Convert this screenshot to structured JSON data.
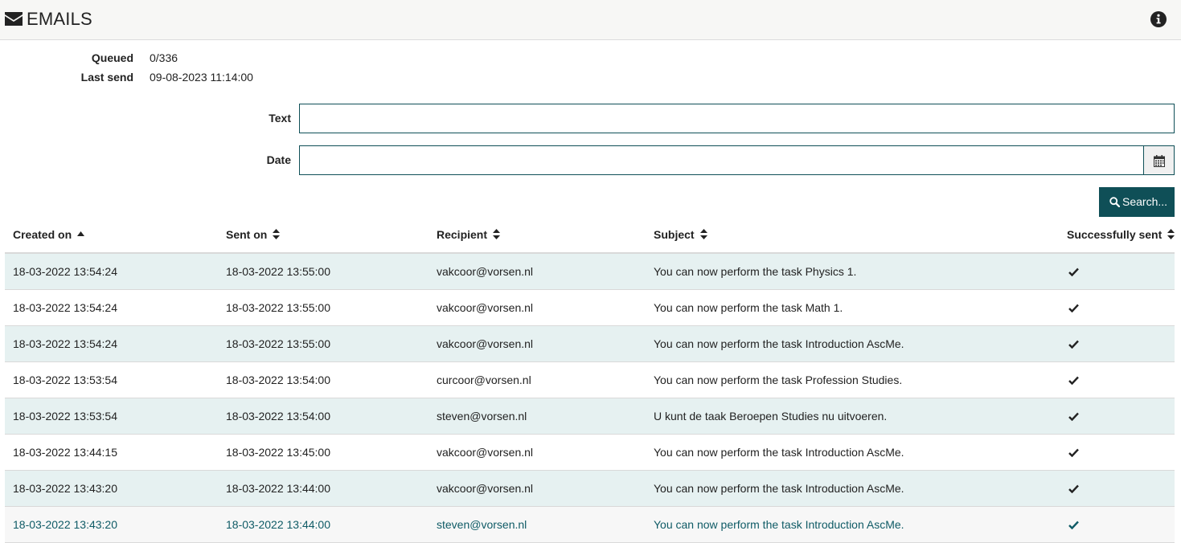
{
  "header": {
    "title": "EMAILS",
    "icon": "envelope-icon",
    "info_icon": "info-circle-icon"
  },
  "meta": {
    "queued_label": "Queued",
    "queued_value": "0/336",
    "last_send_label": "Last send",
    "last_send_value": "09-08-2023 11:14:00"
  },
  "filters": {
    "text_label": "Text",
    "text_value": "",
    "date_label": "Date",
    "date_value": "",
    "search_label": "Search..."
  },
  "table": {
    "columns": [
      {
        "label": "Created on",
        "sort": "ascending"
      },
      {
        "label": "Sent on",
        "sort": "none"
      },
      {
        "label": "Recipient",
        "sort": "none"
      },
      {
        "label": "Subject",
        "sort": "none"
      },
      {
        "label": "Successfully sent",
        "sort": "none"
      }
    ],
    "rows": [
      {
        "created": "18-03-2022 13:54:24",
        "sent": "18-03-2022 13:55:00",
        "recipient": "vakcoor@vorsen.nl",
        "subject": "You can now perform the task Physics 1.",
        "success": true
      },
      {
        "created": "18-03-2022 13:54:24",
        "sent": "18-03-2022 13:55:00",
        "recipient": "vakcoor@vorsen.nl",
        "subject": "You can now perform the task Math 1.",
        "success": true
      },
      {
        "created": "18-03-2022 13:54:24",
        "sent": "18-03-2022 13:55:00",
        "recipient": "vakcoor@vorsen.nl",
        "subject": "You can now perform the task Introduction AscMe.",
        "success": true
      },
      {
        "created": "18-03-2022 13:53:54",
        "sent": "18-03-2022 13:54:00",
        "recipient": "curcoor@vorsen.nl",
        "subject": "You can now perform the task Profession Studies.",
        "success": true
      },
      {
        "created": "18-03-2022 13:53:54",
        "sent": "18-03-2022 13:54:00",
        "recipient": "steven@vorsen.nl",
        "subject": "U kunt de taak Beroepen Studies nu uitvoeren.",
        "success": true
      },
      {
        "created": "18-03-2022 13:44:15",
        "sent": "18-03-2022 13:45:00",
        "recipient": "vakcoor@vorsen.nl",
        "subject": "You can now perform the task Introduction AscMe.",
        "success": true
      },
      {
        "created": "18-03-2022 13:43:20",
        "sent": "18-03-2022 13:44:00",
        "recipient": "vakcoor@vorsen.nl",
        "subject": "You can now perform the task Introduction AscMe.",
        "success": true
      },
      {
        "created": "18-03-2022 13:43:20",
        "sent": "18-03-2022 13:44:00",
        "recipient": "steven@vorsen.nl",
        "subject": "You can now perform the task Introduction AscMe.",
        "success": true
      }
    ]
  },
  "colors": {
    "accent": "#0f4f57",
    "stripe": "#e6f1f1",
    "hover_text": "#0f5b66"
  }
}
